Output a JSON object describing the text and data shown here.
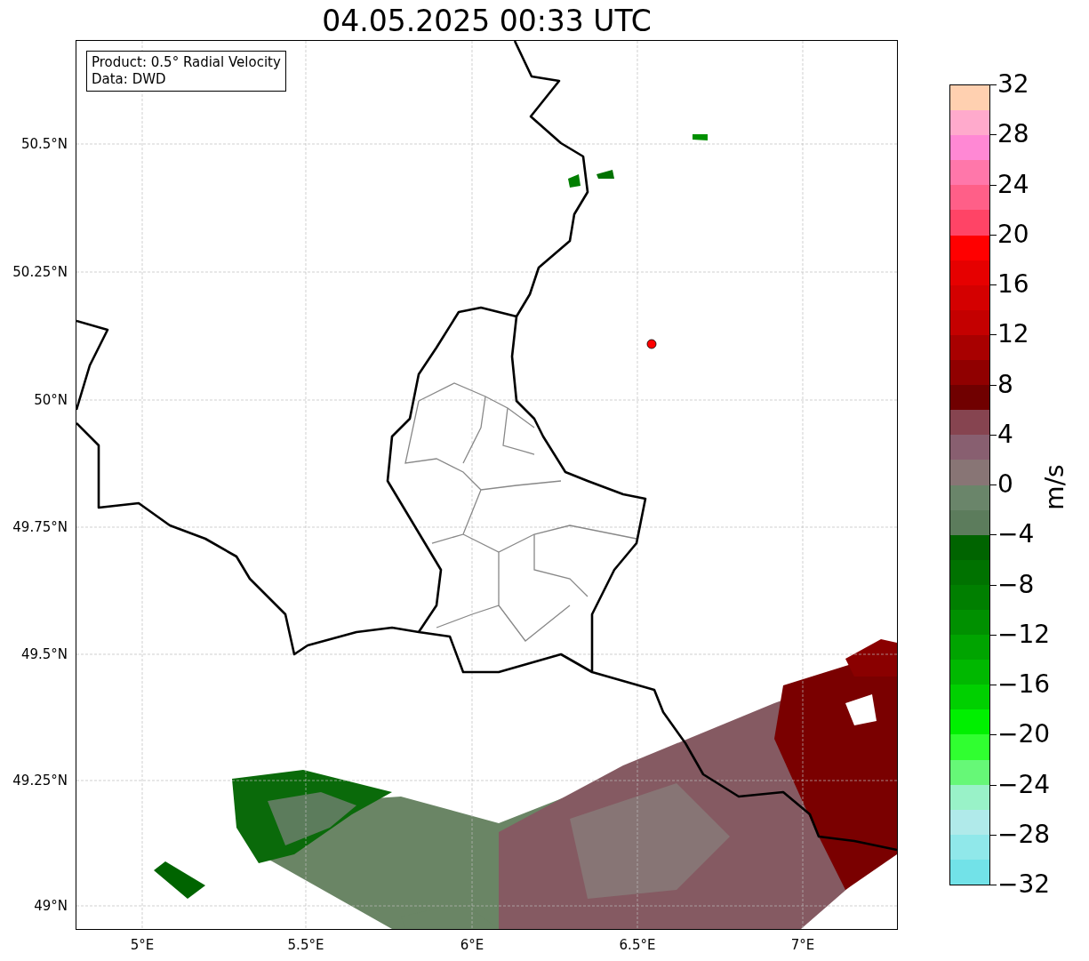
{
  "title": "04.05.2025 00:33 UTC",
  "info_box": {
    "lines": [
      "Product: 0.5° Radial Velocity",
      "Data: DWD"
    ]
  },
  "map": {
    "y_labels": [
      "50.5°N",
      "50.25°N",
      "50°N",
      "49.75°N",
      "49.5°N",
      "49.25°N",
      "49°N"
    ],
    "x_labels": [
      "5°E",
      "5.5°E",
      "6°E",
      "6.5°E",
      "7°E"
    ]
  },
  "colorbar": {
    "label": "m/s",
    "ticks": [
      "32",
      "28",
      "24",
      "20",
      "16",
      "12",
      "8",
      "4",
      "0",
      "−4",
      "−8",
      "−12",
      "−16",
      "−20",
      "−24",
      "−28",
      "−32"
    ]
  }
}
